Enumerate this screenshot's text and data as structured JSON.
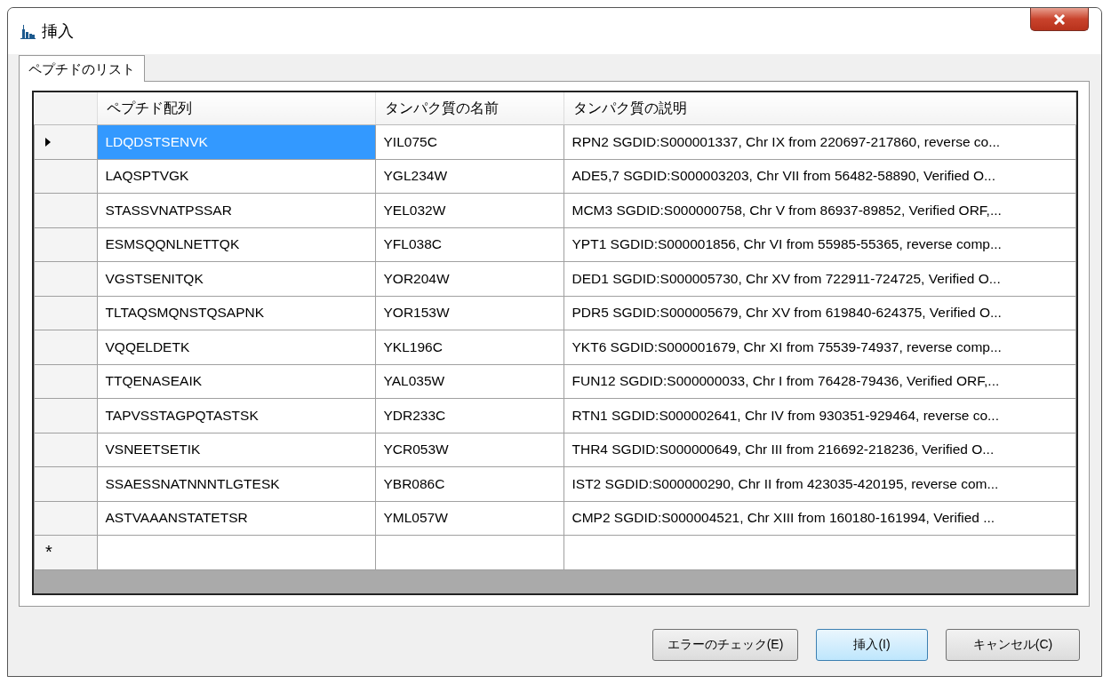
{
  "window": {
    "title": "挿入"
  },
  "tabs": [
    {
      "label": "ペプチドのリスト",
      "selected": true
    }
  ],
  "table": {
    "columns": [
      "ペプチド配列",
      "タンパク質の名前",
      "タンパク質の説明"
    ],
    "rows": [
      {
        "selected": true,
        "cells": [
          "LDQDSTSENVK",
          "YIL075C",
          "RPN2 SGDID:S000001337, Chr IX from 220697-217860, reverse co..."
        ]
      },
      {
        "selected": false,
        "cells": [
          "LAQSPTVGK",
          "YGL234W",
          "ADE5,7 SGDID:S000003203, Chr VII from 56482-58890, Verified O..."
        ]
      },
      {
        "selected": false,
        "cells": [
          "STASSVNATPSSAR",
          "YEL032W",
          "MCM3 SGDID:S000000758, Chr V from 86937-89852, Verified ORF,..."
        ]
      },
      {
        "selected": false,
        "cells": [
          "ESMSQQNLNETTQK",
          "YFL038C",
          "YPT1 SGDID:S000001856, Chr VI from 55985-55365, reverse comp..."
        ]
      },
      {
        "selected": false,
        "cells": [
          "VGSTSENITQK",
          "YOR204W",
          "DED1 SGDID:S000005730, Chr XV from 722911-724725, Verified O..."
        ]
      },
      {
        "selected": false,
        "cells": [
          "TLTAQSMQNSTQSAPNK",
          "YOR153W",
          "PDR5 SGDID:S000005679, Chr XV from 619840-624375, Verified O..."
        ]
      },
      {
        "selected": false,
        "cells": [
          "VQQELDETK",
          "YKL196C",
          "YKT6 SGDID:S000001679, Chr XI from 75539-74937, reverse comp..."
        ]
      },
      {
        "selected": false,
        "cells": [
          "TTQENASEAIK",
          "YAL035W",
          "FUN12 SGDID:S000000033, Chr I from 76428-79436, Verified ORF,..."
        ]
      },
      {
        "selected": false,
        "cells": [
          "TAPVSSTAGPQTASTSK",
          "YDR233C",
          "RTN1 SGDID:S000002641, Chr IV from 930351-929464, reverse co..."
        ]
      },
      {
        "selected": false,
        "cells": [
          "VSNEETSETIK",
          "YCR053W",
          "THR4 SGDID:S000000649, Chr III from 216692-218236, Verified O..."
        ]
      },
      {
        "selected": false,
        "cells": [
          "SSAESSNATNNNTLGTESK",
          "YBR086C",
          "IST2 SGDID:S000000290, Chr II from 423035-420195, reverse com..."
        ]
      },
      {
        "selected": false,
        "cells": [
          "ASTVAAANSTATETSR",
          "YML057W",
          "CMP2 SGDID:S000004521, Chr XIII from 160180-161994, Verified ..."
        ]
      }
    ],
    "new_row_marker": "*"
  },
  "buttons": [
    {
      "label": "エラーのチェック(E)",
      "default": false
    },
    {
      "label": "挿入(I)",
      "default": true
    },
    {
      "label": "キャンセル(C)",
      "default": false
    }
  ]
}
